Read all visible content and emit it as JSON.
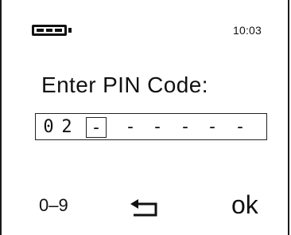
{
  "status_bar": {
    "battery_icon": "battery-icon",
    "time": "10:03"
  },
  "prompt": {
    "label": "Enter PIN Code:"
  },
  "pin": {
    "slots": [
      "0",
      "2",
      "-",
      "-",
      "-",
      "-",
      "-",
      "-"
    ],
    "active_index": 2
  },
  "softkeys": {
    "left": "0–9",
    "center_icon": "back-arrow-icon",
    "right": "ok"
  }
}
